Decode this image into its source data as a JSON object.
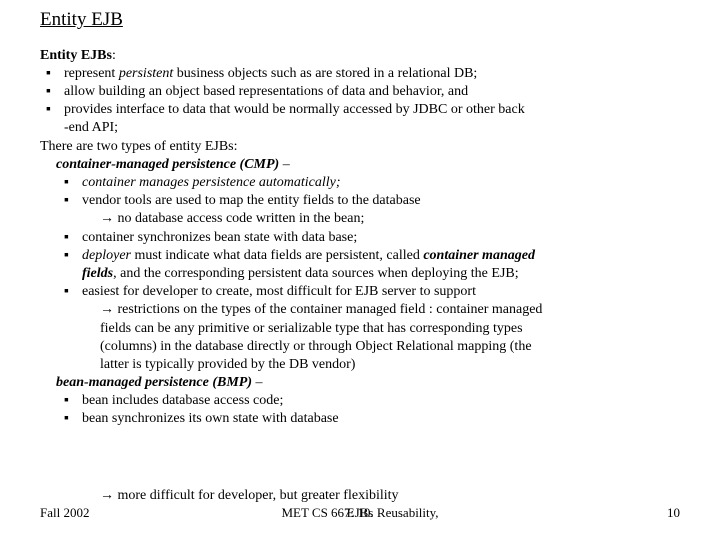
{
  "title": "Entity EJB",
  "subtitle_bold": "Entity EJBs",
  "subtitle_colon": ":",
  "bullets_top": [
    {
      "pre": "represent ",
      "em": "persistent",
      "post": " business objects such as are stored in a relational DB;"
    },
    {
      "text": "allow building an object based representations of data and behavior, and"
    },
    {
      "text": "provides interface to data that would be normally accessed by JDBC or other back"
    }
  ],
  "top_cont": "-end API;",
  "two_types": "There are two types of entity EJBs:",
  "cmp_title": "container-managed persistence (CMP)",
  "cmp_dash": " –",
  "cmp_bullets": {
    "b1": "container manages persistence automatically;",
    "b2": "vendor tools are used to map the entity fields to the database",
    "b2_arrow": " no database access code written in the bean;",
    "b3": "container synchronizes bean state with data base;",
    "b4_em": "deployer",
    "b4_post": " must indicate what data fields are persistent, called ",
    "b4_bold": "container managed",
    "b4_line2_bold": "fields",
    "b4_line2_post": ", and the corresponding persistent data sources when deploying the EJB;",
    "b5": "easiest for developer to create, most difficult for EJB server to support",
    "b5_arrow": " restrictions on the types of the container managed field : container managed",
    "b5_c1": "fields can be any primitive or serializable type that has corresponding types",
    "b5_c2": "(columns) in the database directly or through Object Relational mapping (the",
    "b5_c3": "latter is typically provided by the DB vendor)"
  },
  "bmp_title": "bean-managed persistence (BMP)",
  "bmp_dash": " –",
  "bmp_bullets": {
    "b1": "bean includes database access code;",
    "b2": "bean synchronizes its own state with database"
  },
  "overlap_arrow_text": "more difficult for developer, but greater flexibility",
  "arrow_glyph": "→",
  "footer": {
    "left": "Fall 2002",
    "center": "MET CS 667: 10. Reusability,",
    "center2": "EJBs",
    "right": "10"
  }
}
